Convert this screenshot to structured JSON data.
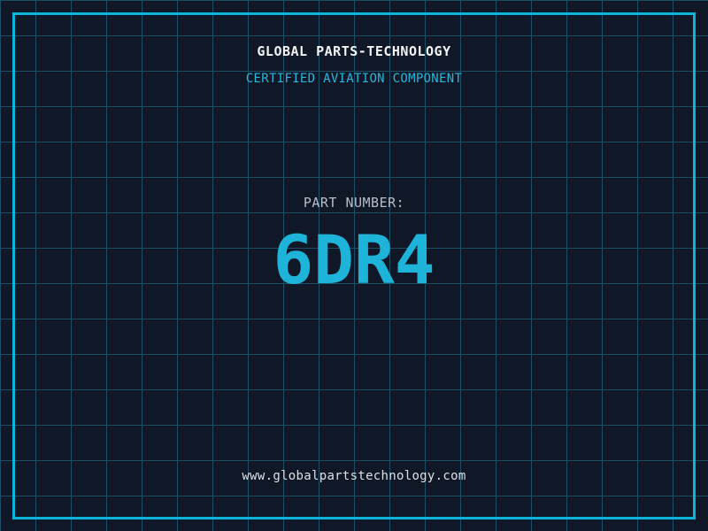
{
  "header": {
    "company": "GLOBAL PARTS-TECHNOLOGY",
    "tagline": "CERTIFIED AVIATION COMPONENT"
  },
  "part": {
    "label": "PART NUMBER:",
    "number": "6DR4"
  },
  "footer": {
    "website": "www.globalpartstechnology.com"
  },
  "colors": {
    "background": "#101827",
    "grid_line": "#1d4e66",
    "frame": "#0db4da",
    "accent_cyan": "#2ab5d9",
    "part_cyan": "#1eb3d9",
    "text_white": "#f2f4f6",
    "text_gray": "#b7bec8",
    "text_url": "#dce1e6"
  }
}
